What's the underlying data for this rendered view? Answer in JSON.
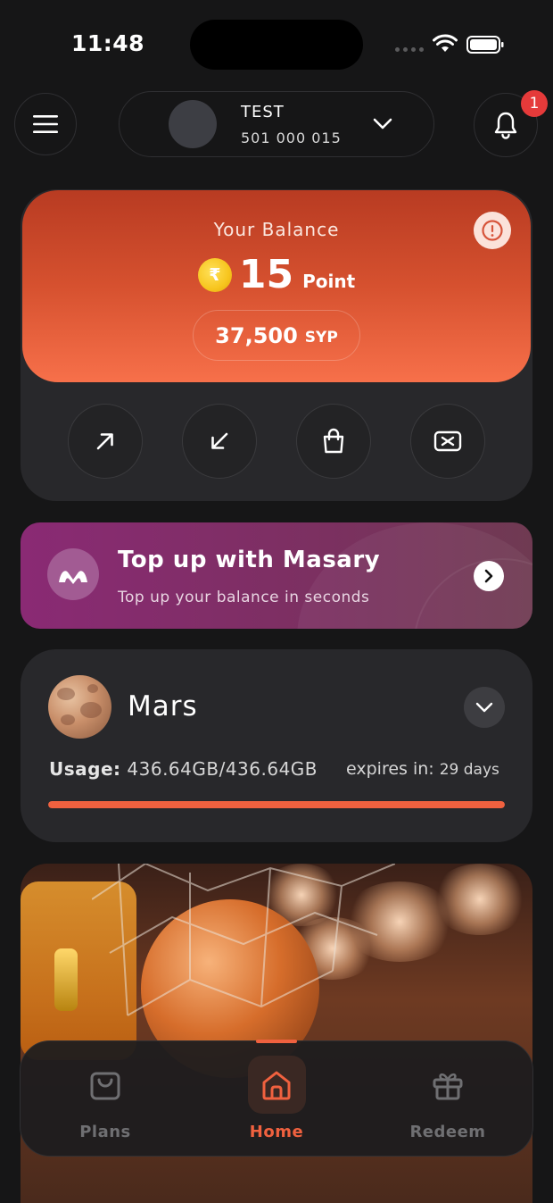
{
  "status_bar": {
    "time": "11:48"
  },
  "header": {
    "account_name": "TEST",
    "account_number": "501 000 015",
    "notification_count": "1"
  },
  "balance": {
    "label": "Your Balance",
    "points": "15",
    "points_unit": "Point",
    "currency_value": "37,500",
    "currency_unit": "SYP",
    "coin_symbol": "₹"
  },
  "actions": [
    {
      "icon": "arrow-up-right-icon"
    },
    {
      "icon": "arrow-down-left-icon"
    },
    {
      "icon": "shopping-bag-icon"
    },
    {
      "icon": "ticket-icon"
    }
  ],
  "promo": {
    "title": "Top up with Masary",
    "subtitle": "Top up your balance in seconds"
  },
  "plan": {
    "name": "Mars",
    "usage_label": "Usage:",
    "usage_value": "436.64GB/436.64GB",
    "expires_label": "expires in:",
    "expires_value": "29 days",
    "usage_fraction": 1.0
  },
  "nav": {
    "items": [
      {
        "label": "Plans",
        "icon": "shopping-bag-icon",
        "active": false
      },
      {
        "label": "Home",
        "icon": "home-icon",
        "active": true
      },
      {
        "label": "Redeem",
        "icon": "gift-icon",
        "active": false
      }
    ]
  },
  "colors": {
    "accent": "#f0613f",
    "promo": "#8a2a74",
    "background": "#161617",
    "card": "#28282b",
    "badge": "#e53a3a"
  }
}
